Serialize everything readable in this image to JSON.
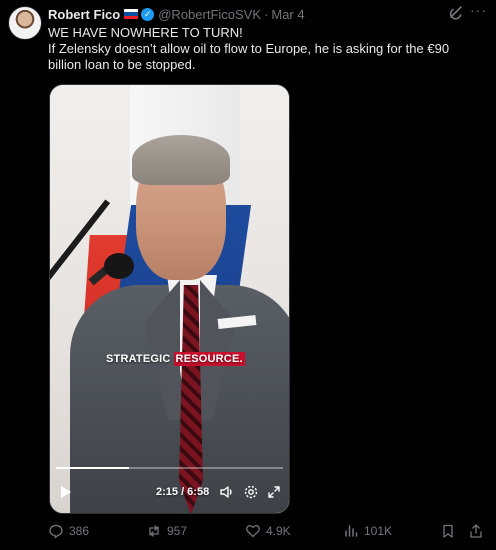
{
  "author": {
    "name": "Robert Fico",
    "handle": "@RobertFicoSVK",
    "separator": "·",
    "date": "Mar 4"
  },
  "tweet": {
    "line1": "WE HAVE NOWHERE TO TURN!",
    "line2": "If Zelensky doesn’t allow oil to flow to Europe, he is asking for the €90 billion loan to be stopped."
  },
  "video": {
    "caption_plain": "STRATEGIC",
    "caption_highlight": "RESOURCE.",
    "time": "2:15 / 6:58",
    "progress": 0.32
  },
  "actions": {
    "replies": "386",
    "reposts": "957",
    "likes": "4.9K",
    "views": "101K"
  },
  "icons": {
    "more": "more-dots-icon",
    "grok": "grok-icon",
    "verified": "verified-badge-icon"
  },
  "colors": {
    "accent": "#1d9bf0",
    "muted": "#71767b",
    "text": "#e7e9ea",
    "caption_highlight": "#c8102e"
  }
}
